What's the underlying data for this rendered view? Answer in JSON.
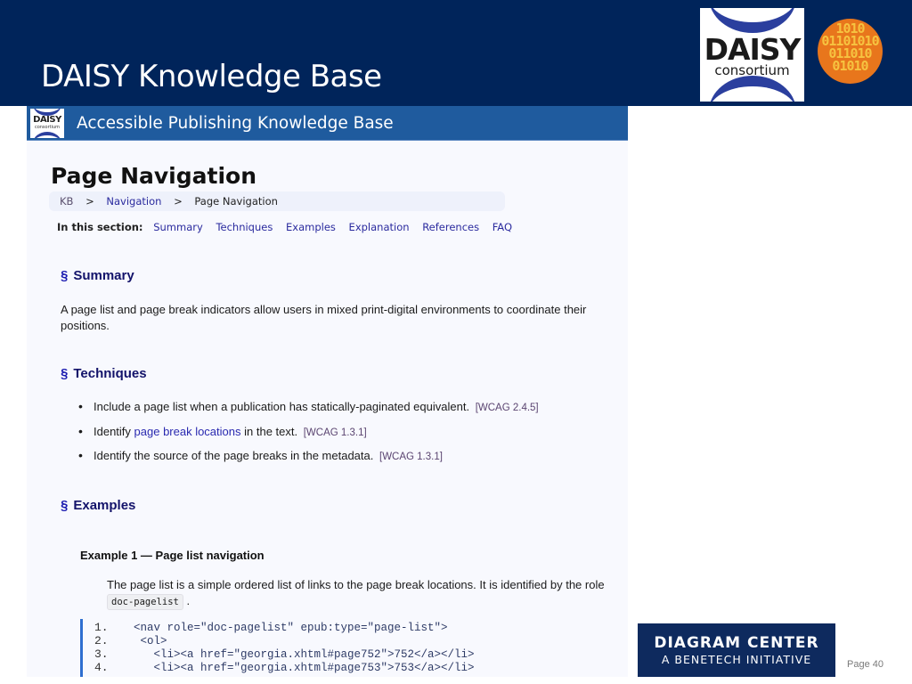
{
  "slide": {
    "title": "DAISY Knowledge Base",
    "page_label": "Page 40",
    "logos": {
      "daisy_big": "DAISY",
      "daisy_small": "consortium",
      "binary_text": "1010 01101010 011010 01010",
      "diagram_line1": "DIAGRAM CENTER",
      "diagram_line2": "A BENETECH INITIATIVE"
    },
    "colors": {
      "header_bg": "#00245a",
      "kb_banner_bg": "#1f5b9e",
      "link": "#2a2a9e",
      "section_heading": "#13136a",
      "code_border": "#2f6fd0"
    }
  },
  "kb": {
    "banner_title": "Accessible Publishing Knowledge Base",
    "banner_logo_big": "DAISY",
    "banner_logo_small": "consortium",
    "page_title": "Page Navigation",
    "breadcrumb": [
      "KB",
      ">",
      "Navigation",
      ">",
      "Page Navigation"
    ],
    "section_nav": {
      "label": "In this section:",
      "links": [
        "Summary",
        "Techniques",
        "Examples",
        "Explanation",
        "References",
        "FAQ"
      ]
    },
    "sections": {
      "summary": {
        "marker": "§",
        "heading": "Summary",
        "text": "A page list and page break indicators allow users in mixed print-digital environments to coordinate their positions."
      },
      "techniques": {
        "marker": "§",
        "heading": "Techniques",
        "items": [
          {
            "pre": "Include a page list when a publication has statically-paginated equivalent.",
            "link": "",
            "post": "",
            "ref": "[WCAG 2.4.5]"
          },
          {
            "pre": "Identify ",
            "link": "page break locations",
            "post": " in the text.",
            "ref": "[WCAG 1.3.1]"
          },
          {
            "pre": "Identify the source of the page breaks in the metadata.",
            "link": "",
            "post": "",
            "ref": "[WCAG 1.3.1]"
          }
        ]
      },
      "examples": {
        "marker": "§",
        "heading": "Examples",
        "example1": {
          "title": "Example 1 — Page list navigation",
          "desc": "The page list is a simple ordered list of links to the page break locations. It is identified by the role",
          "code_chip": "doc-pagelist",
          "desc_end": ".",
          "code_lines": [
            {
              "num": "1.",
              "text": "<nav role=\"doc-pagelist\" epub:type=\"page-list\">"
            },
            {
              "num": "2.",
              "text": " <ol>"
            },
            {
              "num": "3.",
              "text": "   <li><a href=\"georgia.xhtml#page752\">752</a></li>"
            },
            {
              "num": "4.",
              "text": "   <li><a href=\"georgia.xhtml#page753\">753</a></li>"
            }
          ]
        }
      }
    }
  }
}
